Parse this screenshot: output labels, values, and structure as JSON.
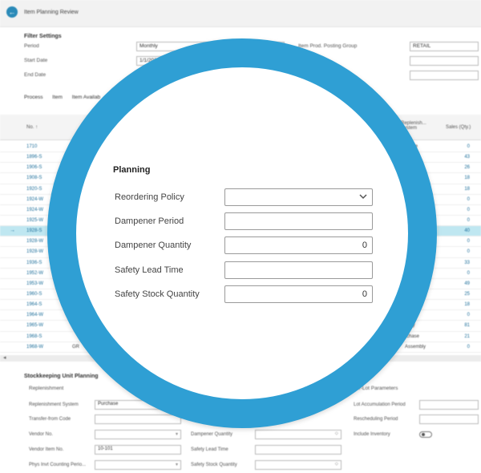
{
  "header": {
    "title": "Item Planning Review"
  },
  "filter": {
    "title": "Filter Settings",
    "period_label": "Period",
    "period_value": "Monthly",
    "start_label": "Start Date",
    "start_value": "1/1/202",
    "end_label": "End Date",
    "posting_group_label": "Item Prod. Posting Group",
    "posting_group_value": "RETAIL"
  },
  "actions": [
    "Process",
    "Item",
    "Item Availab"
  ],
  "grid": {
    "col_no": "No. ↑",
    "col_replenishment": "Replenish... System",
    "col_sales": "Sales (Qty.)",
    "rows": [
      {
        "no": "1710",
        "rep": "chase",
        "sales": "0"
      },
      {
        "no": "1896-S",
        "rep": "ble",
        "sales": "43"
      },
      {
        "no": "1906-S",
        "rep": "",
        "sales": "26"
      },
      {
        "no": "1908-S",
        "rep": "",
        "sales": "18"
      },
      {
        "no": "1920-S",
        "rep": "",
        "sales": "18"
      },
      {
        "no": "1924-W",
        "rep": "",
        "sales": "0"
      },
      {
        "no": "1924-W",
        "rep": "",
        "sales": "0"
      },
      {
        "no": "1925-W",
        "rep": "",
        "sales": "0"
      },
      {
        "no": "1928-S",
        "rep": "",
        "sales": "40"
      },
      {
        "no": "1928-W",
        "rep": "",
        "sales": "0"
      },
      {
        "no": "1928-W",
        "rep": "",
        "sales": "0"
      },
      {
        "no": "1936-S",
        "rep": "",
        "sales": "33"
      },
      {
        "no": "1952-W",
        "rep": "",
        "sales": "0"
      },
      {
        "no": "1953-W",
        "rep": "",
        "sales": "49"
      },
      {
        "no": "1960-S",
        "rep": "",
        "sales": "25"
      },
      {
        "no": "1964-S",
        "rep": "",
        "sales": "18"
      },
      {
        "no": "1964-W",
        "rep": "",
        "sales": "0"
      },
      {
        "no": "1965-W",
        "rep": "mbly",
        "sales": "81"
      },
      {
        "no": "1968-S",
        "rep": "rchase",
        "sales": "21"
      },
      {
        "no": "1968-W",
        "rep": "Assembly",
        "sales": "0",
        "extra": "GR"
      }
    ]
  },
  "sku": {
    "title": "Stockkeeping Unit Planning",
    "replenishment_title": "Replenishment",
    "rep_system_label": "Replenishment System",
    "rep_system_value": "Purchase",
    "transfer_label": "Transfer-from Code",
    "vendor_label": "Vendor No.",
    "vendor_item_label": "Vendor Item No.",
    "vendor_item_value": "10-101",
    "phys_label": "Phys Invt Counting Perio...",
    "dampener_qty_label": "Dampener Quantity",
    "safety_lead_label": "Safety Lead Time",
    "safety_stock_label": "Safety Stock Quantity",
    "lot_title": "-for-Lot Parameters",
    "lot_accum_label": "Lot Accumulation Period",
    "resched_label": "Rescheduling Period",
    "include_inv_label": "Include Inventory"
  },
  "planning": {
    "title": "Planning",
    "reordering_policy_label": "Reordering Policy",
    "dampener_period_label": "Dampener Period",
    "dampener_quantity_label": "Dampener Quantity",
    "dampener_quantity_value": "0",
    "safety_lead_time_label": "Safety Lead Time",
    "safety_stock_quantity_label": "Safety Stock Quantity",
    "safety_stock_quantity_value": "0"
  },
  "colors": {
    "ring": "#2f9fd4",
    "link": "#1e6f9b",
    "selected_row": "#bfe7f1"
  }
}
